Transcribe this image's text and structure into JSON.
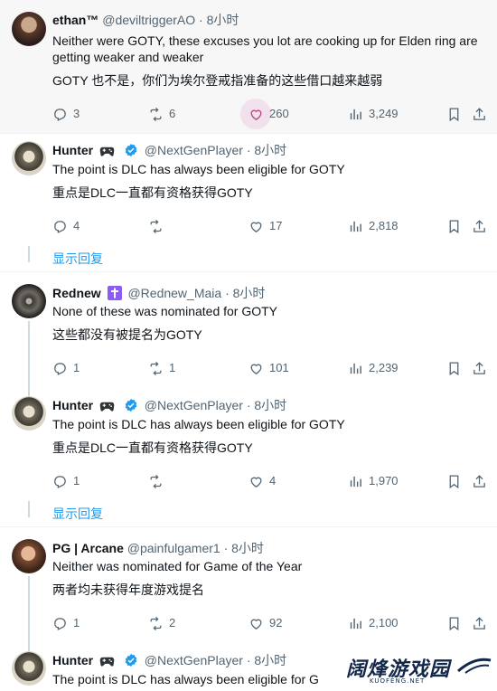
{
  "tweets": [
    {
      "name": "ethan™",
      "handle": "@deviltriggerAO",
      "time": "· 8小时",
      "text_en": "Neither were GOTY, these excuses you lot are cooking up for Elden ring are",
      "text_en2": "getting weaker and weaker",
      "text_cn": "GOTY 也不是，你们为埃尔登戒指准备的这些借口越来越弱",
      "replies": "3",
      "reposts": "6",
      "likes": "260",
      "views": "3,249"
    },
    {
      "name": "Hunter",
      "handle": "@NextGenPlayer",
      "time": "· 8小时",
      "text_en": "The point is DLC has always been eligible for GOTY",
      "text_cn": "重点是DLC一直都有资格获得GOTY",
      "replies": "4",
      "reposts": "",
      "likes": "17",
      "views": "2,818",
      "show_replies": "显示回复"
    },
    {
      "name": "Rednew",
      "handle": "@Rednew_Maia",
      "time": "· 8小时",
      "text_en": "None of these was nominated for GOTY",
      "text_cn": "这些都没有被提名为GOTY",
      "replies": "1",
      "reposts": "1",
      "likes": "101",
      "views": "2,239"
    },
    {
      "name": "Hunter",
      "handle": "@NextGenPlayer",
      "time": "· 8小时",
      "text_en": "The point is DLC has always been eligible for GOTY",
      "text_cn": "重点是DLC一直都有资格获得GOTY",
      "replies": "1",
      "reposts": "",
      "likes": "4",
      "views": "1,970",
      "show_replies": "显示回复"
    },
    {
      "name": "PG | Arcane",
      "handle": "@painfulgamer1",
      "time": "· 8小时",
      "text_en": "Neither was nominated for Game of the Year",
      "text_cn": "两者均未获得年度游戏提名",
      "replies": "1",
      "reposts": "2",
      "likes": "92",
      "views": "2,100"
    },
    {
      "name": "Hunter",
      "handle": "@NextGenPlayer",
      "time": "· 8小时",
      "text_en": "The point is DLC has always been eligible for G"
    }
  ],
  "watermark": {
    "title": "阔烽游戏园",
    "sub": "KUOFENG.NET"
  },
  "colors": {
    "accent": "#1d9bf0",
    "muted": "#536471",
    "verified": "#1d9bf0",
    "badge_purple": "#8b5cf6"
  },
  "icons": [
    "reply-icon",
    "repost-icon",
    "heart-icon",
    "views-icon",
    "bookmark-icon",
    "share-icon",
    "gamepad-icon",
    "verified-icon",
    "cross-badge-icon"
  ]
}
